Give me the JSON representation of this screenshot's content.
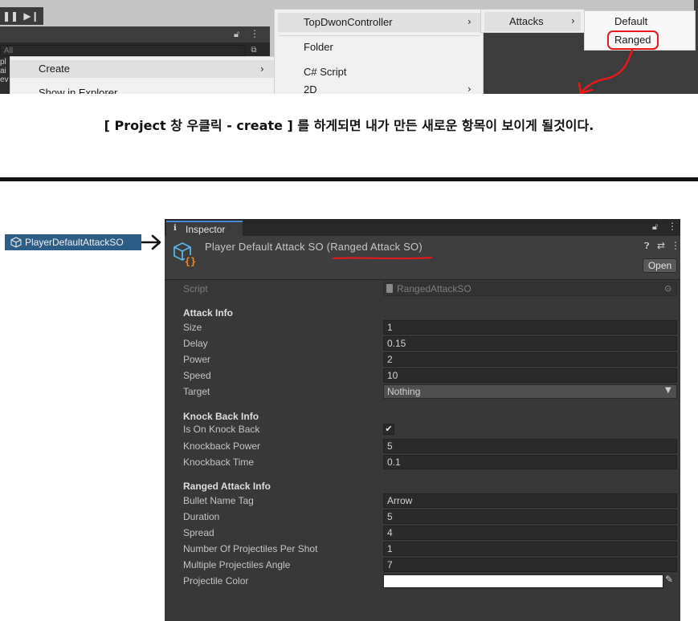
{
  "top_screenshot": {
    "toolbar": {
      "pause_icon": "pause-icon",
      "step_icon": "step-icon"
    },
    "project_search_placeholder": "All",
    "left_edge_text": "pl\nai\nev",
    "context_menu": {
      "create_label": "Create",
      "show_in_explorer_label": "Show in Explorer"
    },
    "create_submenu": {
      "topdown_label": "TopDwonController",
      "folder_label": "Folder",
      "csharp_label": "C# Script",
      "twod_label": "2D"
    },
    "topdown_submenu": {
      "attacks_label": "Attacks"
    },
    "attacks_submenu": {
      "default_label": "Default",
      "ranged_label": "Ranged"
    },
    "highlight_color": "#e81818"
  },
  "caption": "[ Project 창 우클릭 - create ] 를 하게되면 내가 만든 새로운 항목이 보이게 될것이다.",
  "asset": {
    "name": "PlayerDefaultAttackSO",
    "icon": "scriptable-object-icon"
  },
  "inspector": {
    "tab_label": "Inspector",
    "title": "Player Default Attack SO (Ranged Attack SO)",
    "open_label": "Open",
    "script": {
      "label": "Script",
      "value": "RangedAttackSO"
    },
    "attack_info": {
      "header": "Attack Info",
      "size": {
        "label": "Size",
        "value": "1"
      },
      "delay": {
        "label": "Delay",
        "value": "0.15"
      },
      "power": {
        "label": "Power",
        "value": "2"
      },
      "speed": {
        "label": "Speed",
        "value": "10"
      },
      "target": {
        "label": "Target",
        "value": "Nothing"
      }
    },
    "knock_back_info": {
      "header": "Knock Back Info",
      "is_on_knock_back": {
        "label": "Is On Knock Back",
        "checked": true,
        "check_glyph": "✔"
      },
      "knockback_power": {
        "label": "Knockback Power",
        "value": "5"
      },
      "knockback_time": {
        "label": "Knockback Time",
        "value": "0.1"
      }
    },
    "ranged_attack_info": {
      "header": "Ranged Attack Info",
      "bullet_name_tag": {
        "label": "Bullet Name Tag",
        "value": "Arrow"
      },
      "duration": {
        "label": "Duration",
        "value": "5"
      },
      "spread": {
        "label": "Spread",
        "value": "4"
      },
      "number_of_projectiles_per_shot": {
        "label": "Number Of Projectiles Per Shot",
        "value": "1"
      },
      "multiple_projectiles_angle": {
        "label": "Multiple Projectiles Angle",
        "value": "7"
      },
      "projectile_color": {
        "label": "Projectile Color",
        "value": "#ffffff"
      }
    }
  }
}
